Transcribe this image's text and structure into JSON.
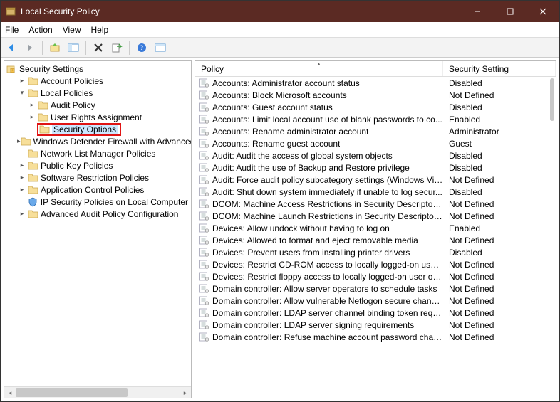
{
  "title": "Local Security Policy",
  "menubar": [
    "File",
    "Action",
    "View",
    "Help"
  ],
  "tree": {
    "root": "Security Settings",
    "items": [
      {
        "label": "Account Policies",
        "expander": "▸",
        "indent": 1
      },
      {
        "label": "Local Policies",
        "expander": "▾",
        "indent": 1
      },
      {
        "label": "Audit Policy",
        "expander": "▸",
        "indent": 2
      },
      {
        "label": "User Rights Assignment",
        "expander": "▸",
        "indent": 2
      },
      {
        "label": "Security Options",
        "expander": "",
        "indent": 2,
        "selected": true
      },
      {
        "label": "Windows Defender Firewall with Advanced Security",
        "expander": "▸",
        "indent": 1
      },
      {
        "label": "Network List Manager Policies",
        "expander": "",
        "indent": 1
      },
      {
        "label": "Public Key Policies",
        "expander": "▸",
        "indent": 1
      },
      {
        "label": "Software Restriction Policies",
        "expander": "▸",
        "indent": 1
      },
      {
        "label": "Application Control Policies",
        "expander": "▸",
        "indent": 1
      },
      {
        "label": "IP Security Policies on Local Computer",
        "expander": "",
        "indent": 1,
        "icon": "shield"
      },
      {
        "label": "Advanced Audit Policy Configuration",
        "expander": "▸",
        "indent": 1
      }
    ]
  },
  "columns": {
    "policy": "Policy",
    "setting": "Security Setting"
  },
  "policies": [
    {
      "name": "Accounts: Administrator account status",
      "setting": "Disabled"
    },
    {
      "name": "Accounts: Block Microsoft accounts",
      "setting": "Not Defined"
    },
    {
      "name": "Accounts: Guest account status",
      "setting": "Disabled"
    },
    {
      "name": "Accounts: Limit local account use of blank passwords to co...",
      "setting": "Enabled"
    },
    {
      "name": "Accounts: Rename administrator account",
      "setting": "Administrator"
    },
    {
      "name": "Accounts: Rename guest account",
      "setting": "Guest"
    },
    {
      "name": "Audit: Audit the access of global system objects",
      "setting": "Disabled"
    },
    {
      "name": "Audit: Audit the use of Backup and Restore privilege",
      "setting": "Disabled"
    },
    {
      "name": "Audit: Force audit policy subcategory settings (Windows Vis...",
      "setting": "Not Defined"
    },
    {
      "name": "Audit: Shut down system immediately if unable to log secur...",
      "setting": "Disabled"
    },
    {
      "name": "DCOM: Machine Access Restrictions in Security Descriptor D...",
      "setting": "Not Defined"
    },
    {
      "name": "DCOM: Machine Launch Restrictions in Security Descriptor ...",
      "setting": "Not Defined"
    },
    {
      "name": "Devices: Allow undock without having to log on",
      "setting": "Enabled"
    },
    {
      "name": "Devices: Allowed to format and eject removable media",
      "setting": "Not Defined"
    },
    {
      "name": "Devices: Prevent users from installing printer drivers",
      "setting": "Disabled"
    },
    {
      "name": "Devices: Restrict CD-ROM access to locally logged-on user ...",
      "setting": "Not Defined"
    },
    {
      "name": "Devices: Restrict floppy access to locally logged-on user only",
      "setting": "Not Defined"
    },
    {
      "name": "Domain controller: Allow server operators to schedule tasks",
      "setting": "Not Defined"
    },
    {
      "name": "Domain controller: Allow vulnerable Netlogon secure chann...",
      "setting": "Not Defined"
    },
    {
      "name": "Domain controller: LDAP server channel binding token requi...",
      "setting": "Not Defined"
    },
    {
      "name": "Domain controller: LDAP server signing requirements",
      "setting": "Not Defined"
    },
    {
      "name": "Domain controller: Refuse machine account password chan...",
      "setting": "Not Defined"
    }
  ]
}
